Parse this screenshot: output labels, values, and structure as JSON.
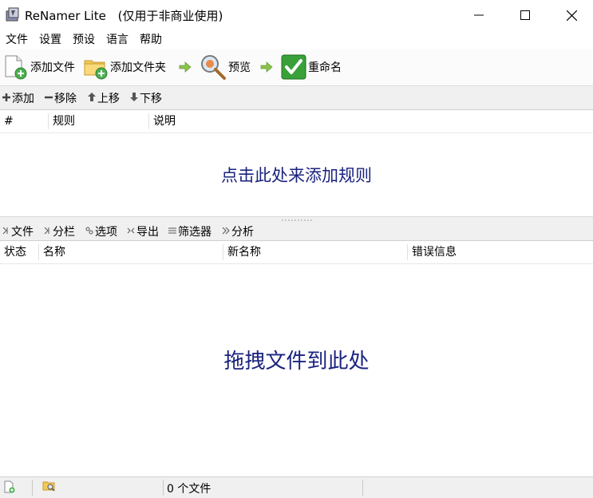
{
  "window": {
    "title": "ReNamer Lite",
    "subtitle": "(仅用于非商业使用)"
  },
  "menu": [
    "文件",
    "设置",
    "预设",
    "语言",
    "帮助"
  ],
  "toolbar": {
    "add_files": "添加文件",
    "add_folder": "添加文件夹",
    "preview": "预览",
    "rename": "重命名"
  },
  "rules_toolbar": {
    "add": "添加",
    "remove": "移除",
    "move_up": "上移",
    "move_down": "下移"
  },
  "rules_table": {
    "columns": [
      "#",
      "规则",
      "说明"
    ],
    "empty_text": "点击此处来添加规则"
  },
  "files_toolbar": {
    "files": "文件",
    "columns": "分栏",
    "options": "选项",
    "export": "导出",
    "filters": "筛选器",
    "analyze": "分析"
  },
  "files_table": {
    "columns": [
      "状态",
      "名称",
      "新名称",
      "错误信息"
    ],
    "empty_text": "拖拽文件到此处"
  },
  "statusbar": {
    "file_count": "0 个文件"
  },
  "colors": {
    "accent_text": "#1a237e",
    "green_check": "#3aa13a"
  }
}
